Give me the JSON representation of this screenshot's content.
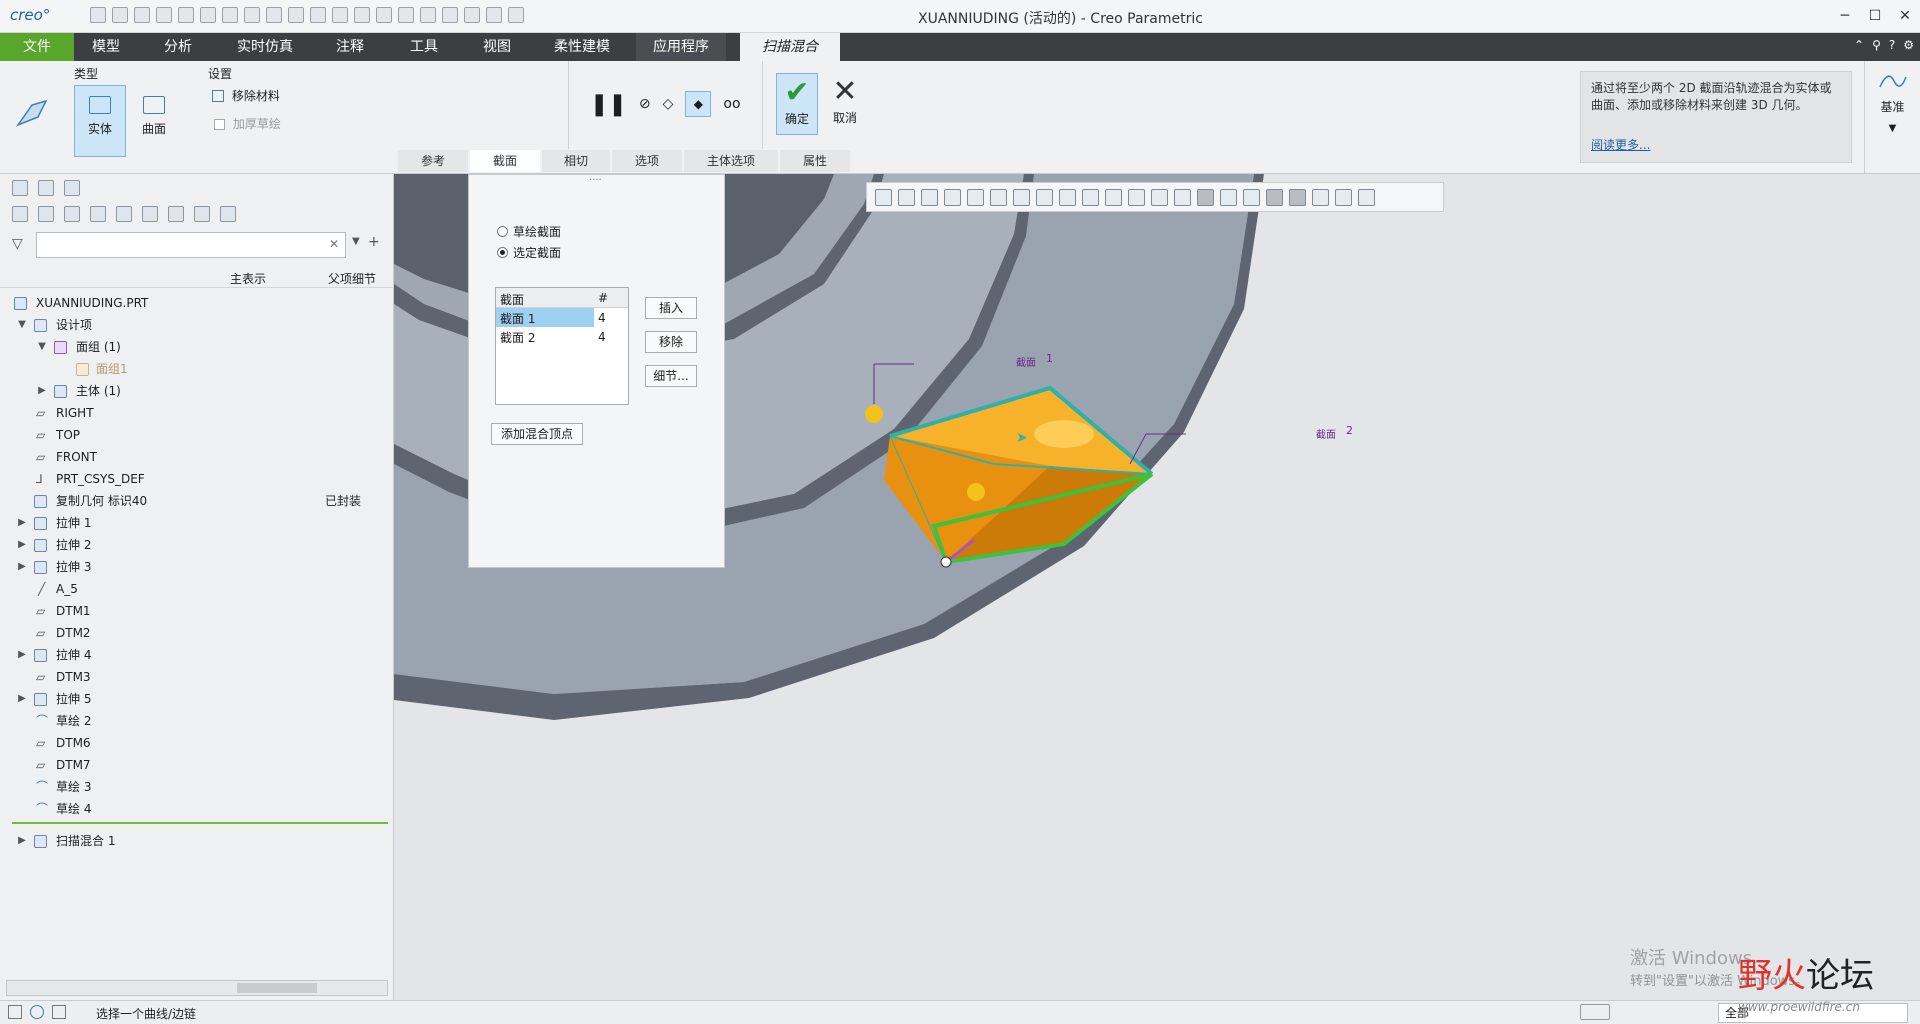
{
  "window": {
    "logo": "creo°",
    "title": "XUANNIUDING (活动的) - Creo Parametric"
  },
  "tabs": [
    {
      "label": "文件"
    },
    {
      "label": "模型"
    },
    {
      "label": "分析"
    },
    {
      "label": "实时仿真"
    },
    {
      "label": "注释"
    },
    {
      "label": "工具"
    },
    {
      "label": "视图"
    },
    {
      "label": "柔性建模"
    },
    {
      "label": "应用程序"
    },
    {
      "label": "扫描混合"
    }
  ],
  "ribbon": {
    "type_label": "类型",
    "solid_label": "实体",
    "surface_label": "曲面",
    "settings_label": "设置",
    "remove_material": "移除材料",
    "thicken_sketch": "加厚草绘",
    "ok_label": "确定",
    "cancel_label": "取消",
    "datum_label": "基准",
    "help_text": "通过将至少两个 2D 截面沿轨迹混合为实体或曲面、添加或移除材料来创建 3D 几何。",
    "help_more": "阅读更多...",
    "subtabs": [
      {
        "label": "参考"
      },
      {
        "label": "截面"
      },
      {
        "label": "相切"
      },
      {
        "label": "选项"
      },
      {
        "label": "主体选项"
      },
      {
        "label": "属性"
      }
    ]
  },
  "tree": {
    "col_main": "主表示",
    "col_parent": "父项细节",
    "items": [
      {
        "label": "XUANNIUDING.PRT"
      },
      {
        "label": "设计项"
      },
      {
        "label": "面组 (1)"
      },
      {
        "label": "面组1"
      },
      {
        "label": "主体 (1)"
      },
      {
        "label": "RIGHT"
      },
      {
        "label": "TOP"
      },
      {
        "label": "FRONT"
      },
      {
        "label": "PRT_CSYS_DEF"
      },
      {
        "label": "复制几何 标识40",
        "tag": "已封装"
      },
      {
        "label": "拉伸 1"
      },
      {
        "label": "拉伸 2"
      },
      {
        "label": "拉伸 3"
      },
      {
        "label": "A_5"
      },
      {
        "label": "DTM1"
      },
      {
        "label": "DTM2"
      },
      {
        "label": "拉伸 4"
      },
      {
        "label": "DTM3"
      },
      {
        "label": "拉伸 5"
      },
      {
        "label": "草绘 2"
      },
      {
        "label": "DTM6"
      },
      {
        "label": "DTM7"
      },
      {
        "label": "草绘 3"
      },
      {
        "label": "草绘 4"
      },
      {
        "label": "扫描混合 1"
      }
    ]
  },
  "section_panel": {
    "sketch_section": "草绘截面",
    "selected_section": "选定截面",
    "table_header": "截面",
    "table_hash": "#",
    "rows": [
      {
        "name": "截面 1",
        "count": "4"
      },
      {
        "name": "截面 2",
        "count": "4"
      }
    ],
    "insert": "插入",
    "remove": "移除",
    "detail": "细节...",
    "add_vertex": "添加混合顶点"
  },
  "viewport": {
    "label1": "截面",
    "label1_num": "1",
    "label2": "截面",
    "label2_num": "2"
  },
  "status": {
    "message": "选择一个曲线/边链",
    "filter": "全部"
  },
  "overlay": {
    "activate": "激活 Windows",
    "activate_sub": "转到\"设置\"以激活 Windows。",
    "forum_a": "野",
    "forum_b": "火",
    "forum_c": "论坛",
    "url": "www.proewildfire.cn"
  },
  "colors": {
    "file_tab": "#58a62b",
    "feature_orange": "#f2a01a",
    "section_green": "#3cc23c",
    "part_blue_gray": "#9aa4b0"
  }
}
